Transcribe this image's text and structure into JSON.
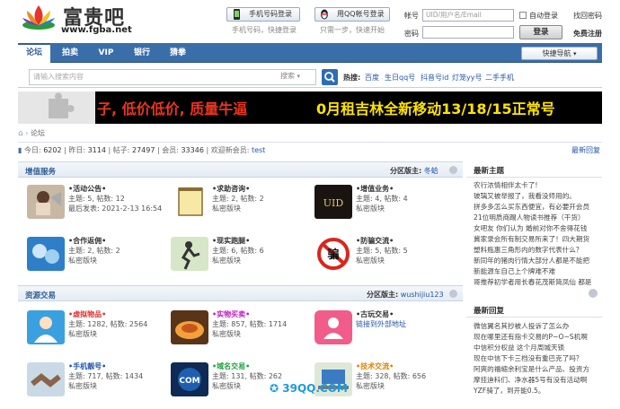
{
  "header": {
    "logo_title": "富贵吧",
    "logo_url": "www.fgba.net",
    "phone_login_label": "手机号码登录",
    "phone_login_hint": "手机号码，快捷登录",
    "qq_login_label": "用QQ帐号登录",
    "qq_login_hint": "只需一步，快速开始",
    "account_label": "帐号",
    "account_placeholder": "UID/用户名/Email",
    "remember_label": "自动登录",
    "forgot_label": "找回密码",
    "password_label": "密码",
    "login_button": "登录",
    "register_label": "免费注册"
  },
  "nav": {
    "items": [
      {
        "label": "论坛",
        "active": true
      },
      {
        "label": "拍卖",
        "active": false
      },
      {
        "label": "VIP",
        "active": false
      },
      {
        "label": "银行",
        "active": false
      },
      {
        "label": "猜拳",
        "active": false
      }
    ],
    "quick_nav": "快捷导航"
  },
  "search": {
    "placeholder": "请输入搜索内容",
    "select_value": "搜索",
    "hot_label": "热搜:",
    "hot_items": [
      "百度",
      "生日qq号",
      "抖音号id",
      "灯笼yy号",
      "二手手机"
    ]
  },
  "banner": {
    "text1": "子, 低价低价, 质量牛逼",
    "text2": "0月租吉林全新移动13/18/15正常号"
  },
  "breadcrumb": {
    "current": "论坛"
  },
  "stats": {
    "today_label": "今日:",
    "today": "6202",
    "yesterday_label": "昨日:",
    "yesterday": "3114",
    "posts_label": "帖子:",
    "posts": "27497",
    "members_label": "会员:",
    "members": "33346",
    "welcome_label": "欢迎新会员:",
    "newest": "test",
    "latest_reply": "最新回复"
  },
  "sections": [
    {
      "title": "增值服务",
      "moderator_label": "分区版主:",
      "moderator": "冬蛤",
      "forums": [
        {
          "name": "•活动公告•",
          "line1": "主题: 5, 帖数: 12",
          "line2": "最后发表: 2021-2-13 16:54",
          "color": "#333"
        },
        {
          "name": "•求助咨询•",
          "line1": "主题: 2, 帖数: 2",
          "line2": "私密版块",
          "color": "#333"
        },
        {
          "name": "•增值业务•",
          "line1": "主题: 4, 帖数: 4",
          "line2": "私密版块",
          "color": "#333"
        },
        {
          "name": "•合作返佣•",
          "line1": "主题: 2, 帖数: 2",
          "line2": "私密版块",
          "color": "#333"
        },
        {
          "name": "•现实跑腿•",
          "line1": "主题: 6, 帖数: 6",
          "line2": "私密版块",
          "color": "#333"
        },
        {
          "name": "•防骗交流•",
          "line1": "主题: 5, 帖数: 5",
          "line2": "私密版块",
          "color": "#333"
        }
      ]
    },
    {
      "title": "资源交易",
      "moderator_label": "分区版主:",
      "moderator": "wushijiu123",
      "forums": [
        {
          "name": "•虚拟物品•",
          "line1": "主题: 1282, 帖数: 2564",
          "line2": "私密版块",
          "color": "#e03030"
        },
        {
          "name": "•实物买卖•",
          "line1": "主题: 857, 帖数: 1714",
          "line2": "私密版块",
          "color": "#c020c0"
        },
        {
          "name": "•古玩交易•",
          "line1": "链接到外部地址",
          "line2": "",
          "color": "#333"
        },
        {
          "name": "•手机靓号•",
          "line1": "主题: 717, 帖数: 1434",
          "line2": "私密版块",
          "color": "#2255aa"
        },
        {
          "name": "•域名交易•",
          "line1": "主题: 131, 帖数: 262",
          "line2": "私密版块",
          "color": "#20a040"
        },
        {
          "name": "•技术交流•",
          "line1": "主题: 328, 帖数: 656",
          "line2": "私密版块",
          "color": "#e08000"
        }
      ]
    }
  ],
  "right": {
    "new_topics_title": "最新主题",
    "new_topics": [
      "农行浓情相伴太卡了!",
      "玻璃又被举报了，我看没师用的。",
      "拼多多怎么买东西便宜，有必要开会员",
      "21位明质商踢人物读书推荐（干货）",
      "女吧友 你们认为 婚前对你不舍得花钱",
      "冀家录会所有制交易所来了！四大期货",
      "塑料瓶惠三角形内的数字代表什么？",
      "新同年的猪肉行情大部分人都是不能把",
      "新能源车自己上个牌难不难",
      "哥推荐初学者用长春花茂斯简凤仙 都是"
    ],
    "new_replies_title": "最新回复",
    "new_replies": [
      "微信翼名其抄被人投诉了怎么办",
      "现在哪里还有指卡交易的P~O~S机啊",
      "中信积分权益 这个月周城天锁",
      "现在中信下卡三档没有重巴克了吗？",
      "阿爽的福缩余利宝是什么产品、投资方",
      "摩挂迪科们、净水器5号有没有活动啊",
      "YZF骑了，到开能0.5。"
    ]
  },
  "watermark": "39QQ.COM"
}
